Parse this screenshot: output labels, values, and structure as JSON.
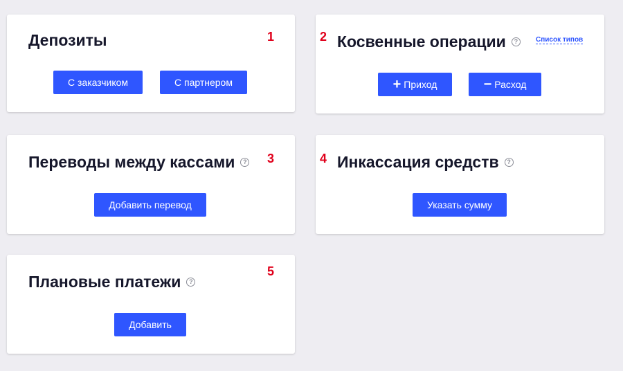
{
  "cards": {
    "deposits": {
      "title": "Депозиты",
      "marker": "1",
      "buttons": [
        "С заказчиком",
        "С партнером"
      ]
    },
    "indirect": {
      "title": "Косвенные операции",
      "marker": "2",
      "help_icon": "?",
      "types_link": "Список типов",
      "buttons": [
        {
          "glyph": "+",
          "label": "Приход"
        },
        {
          "glyph": "−",
          "label": "Расход"
        }
      ]
    },
    "transfers": {
      "title": "Переводы между кассами",
      "marker": "3",
      "help_icon": "?",
      "button": "Добавить перевод"
    },
    "collection": {
      "title": "Инкассация средств",
      "marker": "4",
      "help_icon": "?",
      "button": "Указать сумму"
    },
    "planned": {
      "title": "Плановые платежи",
      "marker": "5",
      "help_icon": "?",
      "button": "Добавить"
    }
  },
  "colors": {
    "background": "#eeedf2",
    "card": "#ffffff",
    "button": "#2f56ff",
    "marker": "#e0001b",
    "title": "#16172b"
  }
}
